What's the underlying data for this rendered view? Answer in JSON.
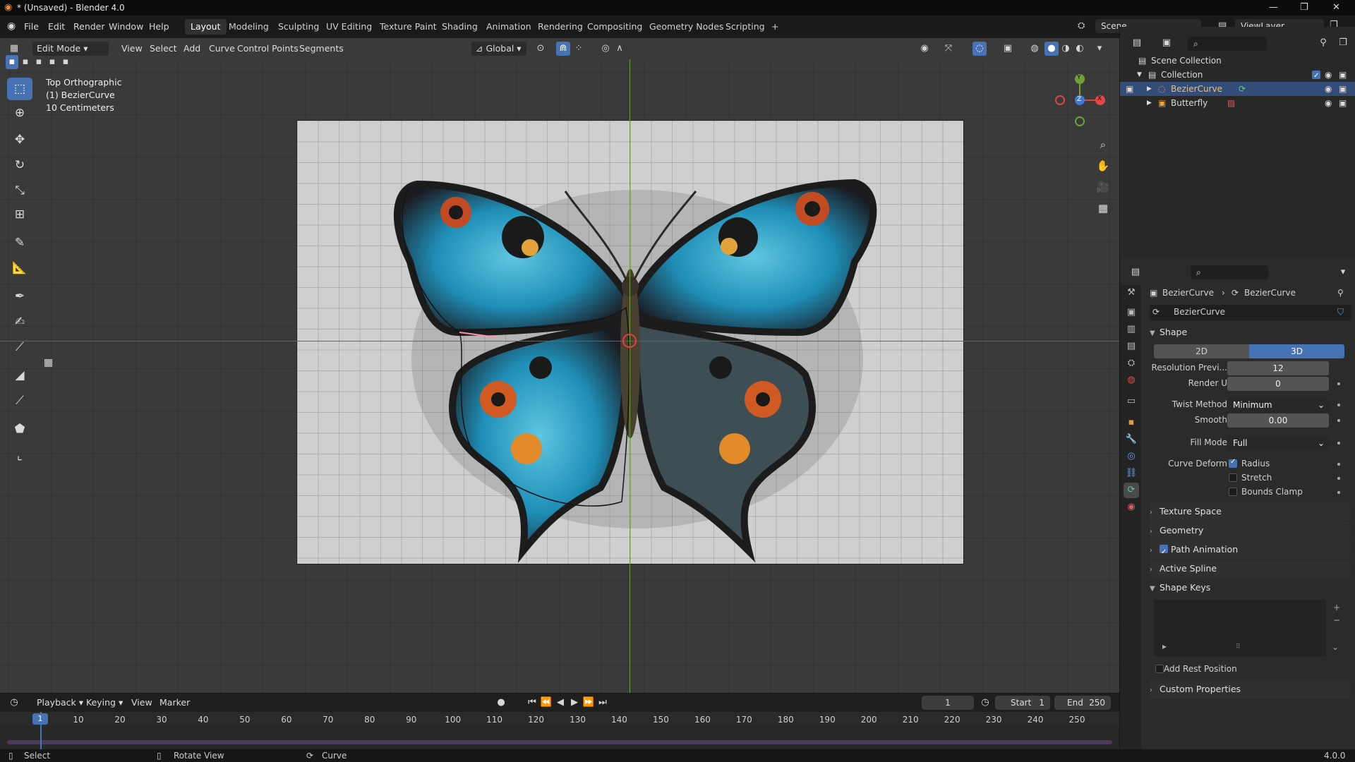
{
  "window": {
    "title": "* (Unsaved) - Blender 4.0"
  },
  "menus": [
    "File",
    "Edit",
    "Render",
    "Window",
    "Help"
  ],
  "workspaces": [
    "Layout",
    "Modeling",
    "Sculpting",
    "UV Editing",
    "Texture Paint",
    "Shading",
    "Animation",
    "Rendering",
    "Compositing",
    "Geometry Nodes",
    "Scripting"
  ],
  "workspace_add": "+",
  "scene": {
    "name": "Scene",
    "view_layer": "ViewLayer"
  },
  "viewport_header": {
    "mode": "Edit Mode",
    "menus": [
      "View",
      "Select",
      "Add",
      "Curve",
      "Control Points",
      "Segments"
    ],
    "transform": "Global"
  },
  "viewport_info": {
    "view": "Top Orthographic",
    "object": "(1) BezierCurve",
    "scale": "10 Centimeters"
  },
  "gizmo": {
    "x": "X",
    "y": "Y",
    "z": "Z"
  },
  "outliner": {
    "scene_collection": "Scene Collection",
    "collection": "Collection",
    "items": [
      "BezierCurve",
      "Butterfly"
    ]
  },
  "properties": {
    "breadcrumb_object": "BezierCurve",
    "breadcrumb_data": "BezierCurve",
    "datablock": "BezierCurve",
    "shape": {
      "title": "Shape",
      "dim_2d": "2D",
      "dim_3d": "3D",
      "resolution_label": "Resolution Previ...",
      "resolution_value": "12",
      "render_u_label": "Render U",
      "render_u_value": "0",
      "twist_label": "Twist Method",
      "twist_value": "Minimum",
      "smooth_label": "Smooth",
      "smooth_value": "0.00",
      "fill_label": "Fill Mode",
      "fill_value": "Full",
      "deform_label": "Curve Deform",
      "radius": "Radius",
      "stretch": "Stretch",
      "bounds": "Bounds Clamp"
    },
    "sections": {
      "texture_space": "Texture Space",
      "geometry": "Geometry",
      "path_animation": "Path Animation",
      "active_spline": "Active Spline",
      "shape_keys": "Shape Keys",
      "add_rest": "Add Rest Position",
      "custom": "Custom Properties"
    }
  },
  "timeline": {
    "menus": [
      "Playback",
      "Keying",
      "View",
      "Marker"
    ],
    "current_frame": "1",
    "start_label": "Start",
    "start": "1",
    "end_label": "End",
    "end": "250",
    "ticks": [
      "1",
      "10",
      "20",
      "30",
      "40",
      "50",
      "60",
      "70",
      "80",
      "90",
      "100",
      "110",
      "120",
      "130",
      "140",
      "150",
      "160",
      "170",
      "180",
      "190",
      "200",
      "210",
      "220",
      "230",
      "240",
      "250"
    ]
  },
  "status": {
    "select": "Select",
    "rotate": "Rotate View",
    "curve": "Curve",
    "version": "4.0.0"
  }
}
